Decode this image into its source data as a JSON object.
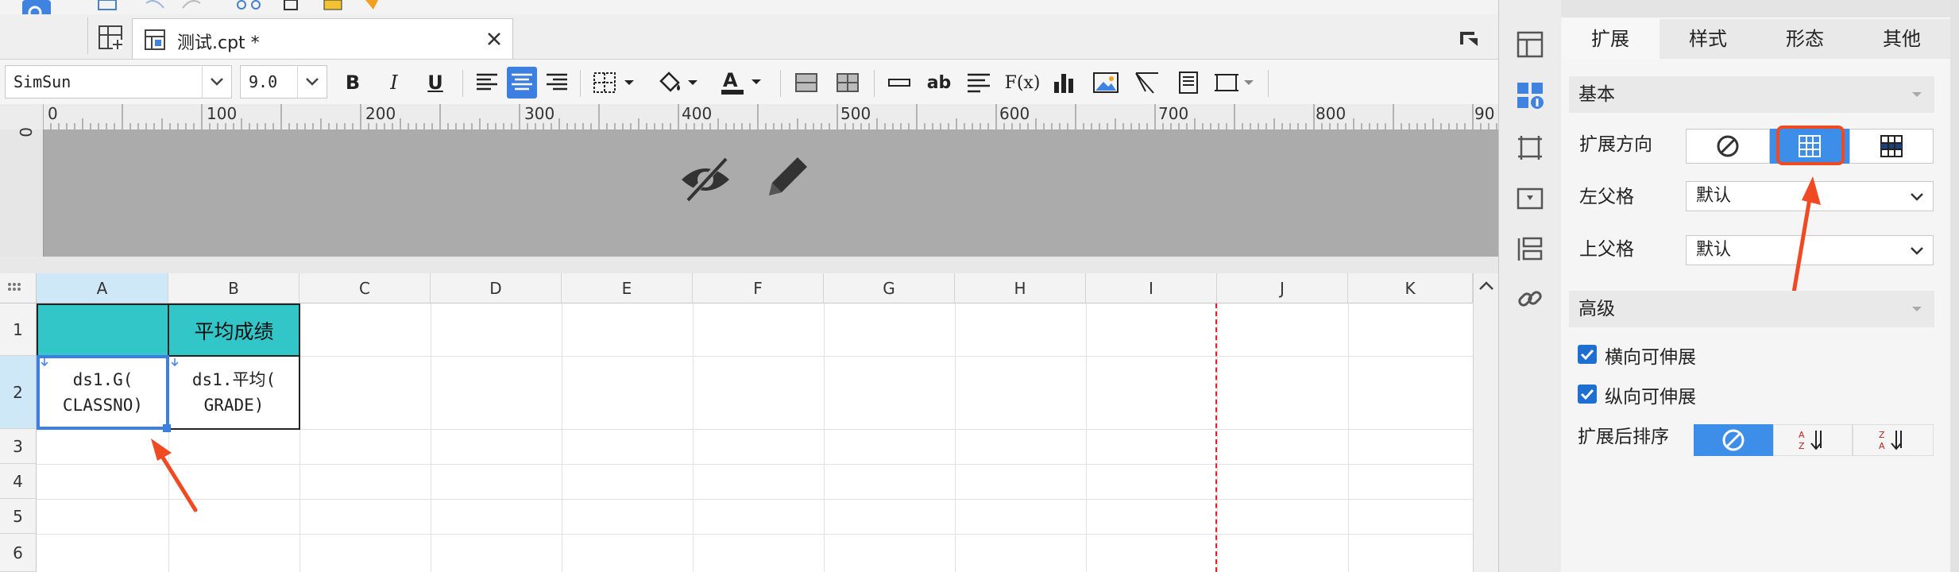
{
  "file_tab": {
    "title": "测试.cpt *"
  },
  "toolbar": {
    "font_name": "SimSun",
    "font_size": "9.0",
    "bold": "B",
    "italic": "I",
    "underline": "U",
    "text_ab": "ab",
    "formula": "F(x)"
  },
  "ruler": {
    "ticks": [
      "0",
      "100",
      "200",
      "300",
      "400",
      "500",
      "600",
      "700",
      "800",
      "90"
    ],
    "vertical_tick": "0"
  },
  "sheet": {
    "columns": [
      "A",
      "B",
      "C",
      "D",
      "E",
      "F",
      "G",
      "H",
      "I",
      "J",
      "K"
    ],
    "rows": [
      "1",
      "2",
      "3",
      "4",
      "5",
      "6"
    ],
    "b1": "平均成绩",
    "a2": "ds1.G(\nCLASSNO)",
    "b2": "ds1.平均(\nGRADE)"
  },
  "panel": {
    "tabs": [
      "扩展",
      "样式",
      "形态",
      "其他"
    ],
    "basic_section": "基本",
    "expand_direction_label": "扩展方向",
    "left_parent_label": "左父格",
    "left_parent_value": "默认",
    "top_parent_label": "上父格",
    "top_parent_value": "默认",
    "advanced_section": "高级",
    "horizontal_stretch": "横向可伸展",
    "vertical_stretch": "纵向可伸展",
    "sort_label": "扩展后排序"
  },
  "colors": {
    "accent": "#3d8ee8",
    "header_cell": "#33c6c9",
    "annotation": "#f04a23",
    "page_break": "#e0202a"
  }
}
